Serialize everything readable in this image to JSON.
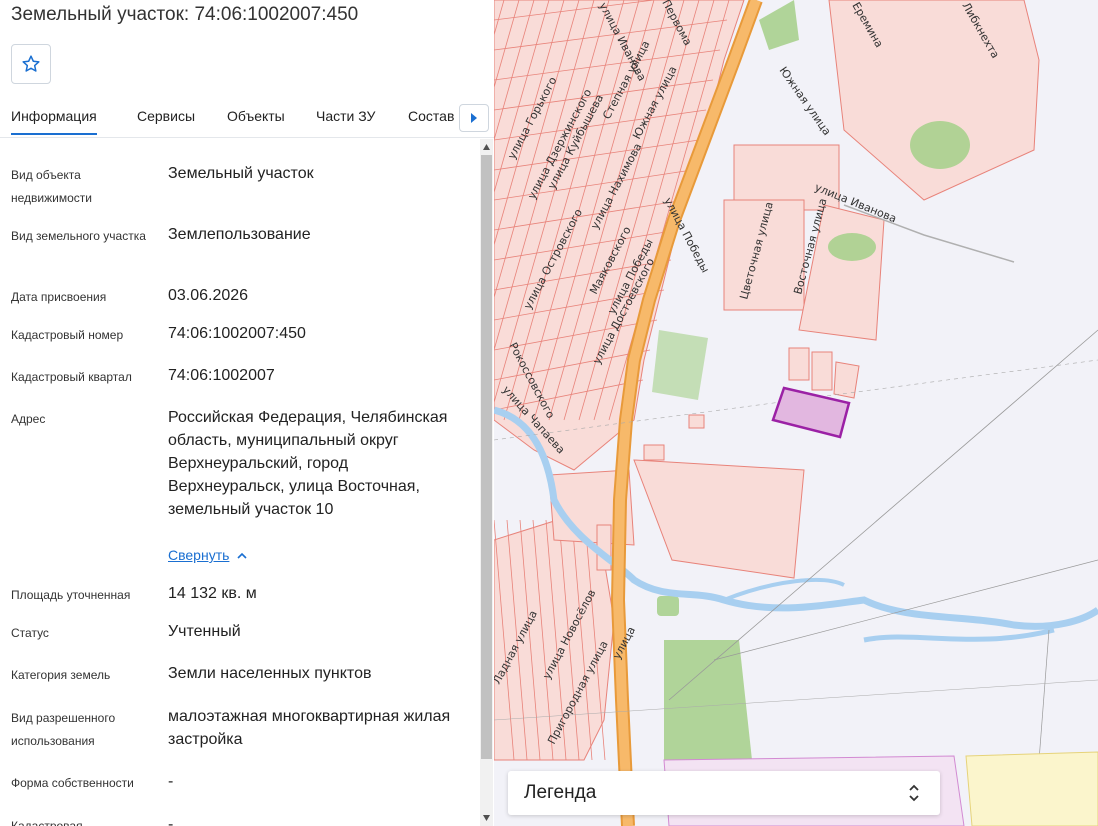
{
  "header": {
    "title": "Земельный участок: 74:06:1002007:450"
  },
  "tabs": [
    {
      "label": "Информация"
    },
    {
      "label": "Сервисы"
    },
    {
      "label": "Объекты"
    },
    {
      "label": "Части ЗУ"
    },
    {
      "label": "Состав"
    }
  ],
  "properties": [
    {
      "label": "Вид объекта недвижимости",
      "value": "Земельный участок"
    },
    {
      "label": "Вид земельного участка",
      "value": "Землепользование"
    },
    {
      "label": "Дата присвоения",
      "value": "03.06.2026"
    },
    {
      "label": "Кадастровый номер",
      "value": "74:06:1002007:450"
    },
    {
      "label": "Кадастровый квартал",
      "value": "74:06:1002007"
    },
    {
      "label": "Адрес",
      "value": "Российская Федерация, Челябинская область, муниципальный округ Верхнеуральский, город Верхнеуральск, улица Восточная, земельный участок 10"
    },
    {
      "label": "Площадь уточненная",
      "value": "14 132 кв. м"
    },
    {
      "label": "Статус",
      "value": "Учтенный"
    },
    {
      "label": "Категория земель",
      "value": "Земли населенных пунктов"
    },
    {
      "label": "Вид разрешенного использования",
      "value": "малоэтажная многоквартирная жилая застройка"
    },
    {
      "label": "Форма собственности",
      "value": "-"
    },
    {
      "label": "Кадастровая",
      "value": "-"
    }
  ],
  "address_collapse": "Свернуть",
  "legend": {
    "label": "Легенда"
  },
  "map": {
    "streets": [
      "улица Иванова",
      "Первома",
      "Еремина",
      "Либкнехта",
      "Южная улица",
      "улица Горького",
      "улица Дзержинского",
      "улица Куйбышева",
      "Степная улица",
      "Южная улица",
      "улица Победы",
      "улица Нахимова",
      "Маяковского",
      "улица Островского",
      "улица Победы",
      "улица Достоевского",
      "Цветочная улица",
      "Восточная улица",
      "улица Иванова",
      "Рокоссовского",
      "улица Чапаева",
      "улица Новосёлов",
      "Пригородная улица",
      "улица",
      "Ладная улица"
    ],
    "colors": {
      "background": "#f2f2f8",
      "parcel_fill": "#f9dcd8",
      "parcel_stroke": "#e8837a",
      "road": "#f7b96a",
      "road_edge": "#e89a3a",
      "green": "#a9d18e",
      "water": "#a8cff0",
      "selected_fill": "#e2b7e0",
      "selected_stroke": "#9b21a5"
    }
  }
}
